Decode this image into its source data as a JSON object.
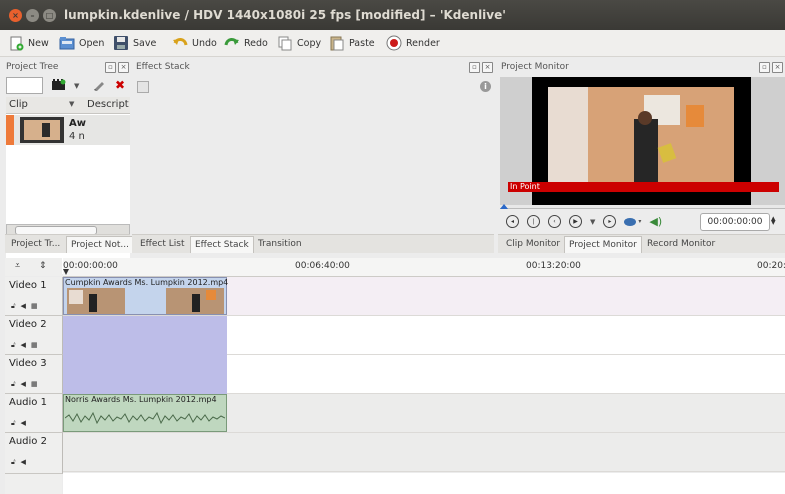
{
  "window": {
    "title": "lumpkin.kdenlive / HDV 1440x1080i 25 fps [modified] – 'Kdenlive'",
    "close_glyph": "×",
    "min_glyph": "–",
    "max_glyph": "□"
  },
  "toolbar": {
    "new": "New",
    "open": "Open",
    "save": "Save",
    "undo": "Undo",
    "redo": "Redo",
    "copy": "Copy",
    "paste": "Paste",
    "render": "Render"
  },
  "project_tree": {
    "title": "Project Tree",
    "col_clip": "Clip",
    "col_desc": "Descript",
    "clip_name": "Aw",
    "clip_meta": "4 n"
  },
  "effect_stack": {
    "title": "Effect Stack"
  },
  "project_monitor": {
    "title": "Project Monitor",
    "in_point": "In Point",
    "timecode": "00:00:00:00"
  },
  "left_tabs": [
    "Project Tr...",
    "Project Not..."
  ],
  "mid_tabs": [
    "Effect List",
    "Effect Stack",
    "Transition"
  ],
  "monitor_tabs": [
    "Clip Monitor",
    "Project Monitor",
    "Record Monitor"
  ],
  "ruler": [
    "00:00:00:00",
    "00:06:40:00",
    "00:13:20:00",
    "00:20:"
  ],
  "tracks": [
    {
      "name": "Video 1",
      "type": "video"
    },
    {
      "name": "Video 2",
      "type": "video"
    },
    {
      "name": "Video 3",
      "type": "video"
    },
    {
      "name": "Audio 1",
      "type": "audio"
    },
    {
      "name": "Audio 2",
      "type": "audio"
    }
  ],
  "clips": {
    "video": "Cumpkin Awards Ms. Lumpkin 2012.mp4",
    "audio": "Norris Awards Ms. Lumpkin 2012.mp4"
  },
  "colors": {
    "accent_red": "#cc0000",
    "track_purple": "#bdbde8",
    "audio_green": "#bfd7bf",
    "clip_orange": "#ee7a3a"
  }
}
